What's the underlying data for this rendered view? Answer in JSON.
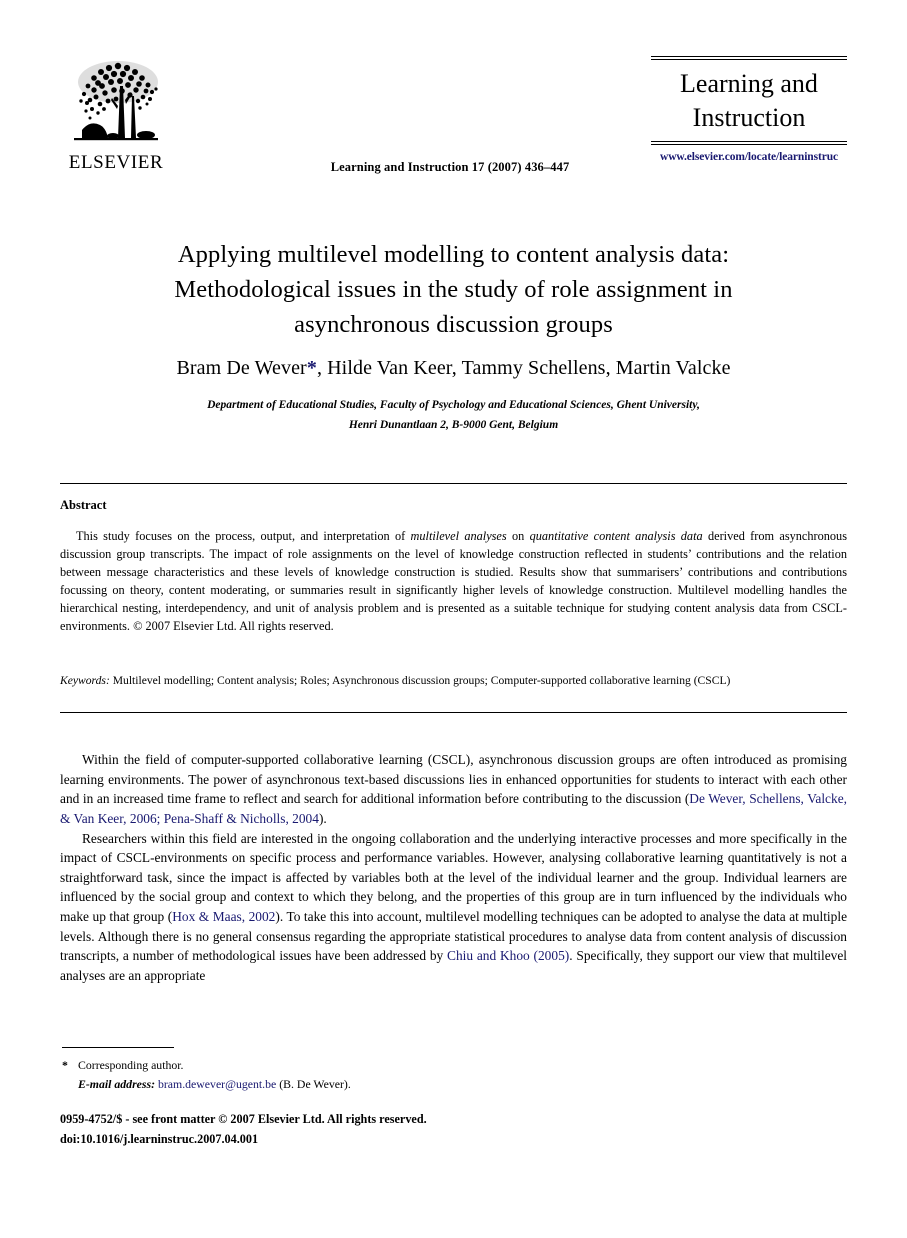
{
  "masthead": {
    "publisher_name": "ELSEVIER",
    "publisher_logo_icon": "elsevier-tree-logo",
    "citation_line": "Learning and Instruction 17 (2007) 436–447",
    "journal_name_line1": "Learning and",
    "journal_name_line2": "Instruction",
    "journal_url": "www.elsevier.com/locate/learninstruc",
    "link_color": "#191970"
  },
  "title": {
    "line1": "Applying multilevel modelling to content analysis data:",
    "line2": "Methodological issues in the study of role assignment in",
    "line3": "asynchronous discussion groups"
  },
  "authors": {
    "first_author": "Bram De Wever",
    "corresponding_marker": "*",
    "rest": ", Hilde Van Keer, Tammy Schellens, Martin Valcke",
    "affiliation_line1": "Department of Educational Studies, Faculty of Psychology and Educational Sciences, Ghent University,",
    "affiliation_line2": "Henri Dunantlaan 2, B-9000 Gent, Belgium"
  },
  "abstract": {
    "heading": "Abstract",
    "part1": "This study focuses on the process, output, and interpretation of ",
    "italic1": "multilevel analyses",
    "part2": " on ",
    "italic2": "quantitative content analysis data",
    "part3": " derived from asynchronous discussion group transcripts. The impact of role assignments on the level of knowledge construction reflected in students’ contributions and the relation between message characteristics and these levels of knowledge construction is studied. Results show that summarisers’ contributions and contributions focussing on theory, content moderating, or summaries result in significantly higher levels of knowledge construction. Multilevel modelling handles the hierarchical nesting, interdependency, and unit of analysis problem and is presented as a suitable technique for studying content analysis data from CSCL-environments. © 2007 Elsevier Ltd. All rights reserved."
  },
  "keywords": {
    "label": "Keywords:",
    "value": " Multilevel modelling; Content analysis; Roles; Asynchronous discussion groups; Computer-supported collaborative learning (CSCL)"
  },
  "body": {
    "paragraph1": {
      "before_citation": "Within the field of computer-supported collaborative learning (CSCL), asynchronous discussion groups are often introduced as promising learning environments. The power of asynchronous text-based discussions lies in enhanced opportunities for students to interact with each other and in an increased time frame to reflect and search for additional information before contributing to the discussion (",
      "citation1": "De Wever, Schellens, Valcke, & Van Keer, 2006",
      "between": "; ",
      "citation2": "Pena-Shaff & Nicholls, 2004",
      "after_citation": ")."
    },
    "paragraph2": {
      "before_citation1": "Researchers within this field are interested in the ongoing collaboration and the underlying interactive processes and more specifically in the impact of CSCL-environments on specific process and performance variables. However, analysing collaborative learning quantitatively is not a straightforward task, since the impact is affected by variables both at the level of the individual learner and the group. Individual learners are influenced by the social group and context to which they belong, and the properties of this group are in turn influenced by the individuals who make up that group (",
      "citation1": "Hox & Maas, 2002",
      "middle": "). To take this into account, multilevel modelling techniques can be adopted to analyse the data at multiple levels. Although there is no general consensus regarding the appropriate statistical procedures to analyse data from content analysis of discussion transcripts, a number of methodological issues have been addressed by ",
      "citation2": "Chiu and Khoo (2005)",
      "after_citation2": ". Specifically, they support our view that multilevel analyses are an appropriate"
    }
  },
  "footnote": {
    "star": "*",
    "corresponding_author": "Corresponding author.",
    "email_label": "E-mail address:",
    "email": "bram.dewever@ugent.be",
    "email_suffix": " (B. De Wever)."
  },
  "imprint": {
    "line1": "0959-4752/$ - see front matter © 2007 Elsevier Ltd. All rights reserved.",
    "line2": "doi:10.1016/j.learninstruc.2007.04.001"
  }
}
